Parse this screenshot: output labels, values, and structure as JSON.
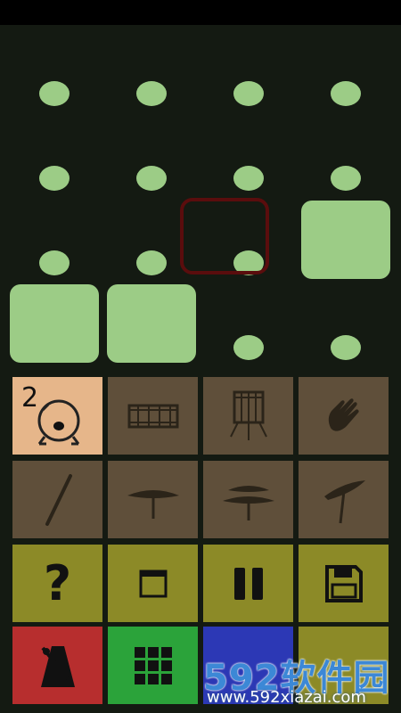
{
  "grid": {
    "dots": [
      {
        "row": 0,
        "col": 0
      },
      {
        "row": 0,
        "col": 1
      },
      {
        "row": 0,
        "col": 2
      },
      {
        "row": 0,
        "col": 3
      },
      {
        "row": 1,
        "col": 0
      },
      {
        "row": 1,
        "col": 1
      },
      {
        "row": 1,
        "col": 2
      },
      {
        "row": 1,
        "col": 3
      },
      {
        "row": 2,
        "col": 0
      },
      {
        "row": 2,
        "col": 1
      },
      {
        "row": 2,
        "col": 2
      },
      {
        "row": 3,
        "col": 2
      },
      {
        "row": 3,
        "col": 3
      }
    ],
    "pads": [
      {
        "row": 2,
        "col": 3
      },
      {
        "row": 3,
        "col": 0
      },
      {
        "row": 3,
        "col": 1
      }
    ],
    "cursor": {
      "row": 2,
      "col": 2
    }
  },
  "instruments": {
    "kick_label": "2",
    "row1": [
      "bass-drum-icon",
      "snare-drum-icon",
      "floor-tom-icon",
      "hand-clap-icon"
    ],
    "row2": [
      "drumstick-icon",
      "hihat-closed-icon",
      "hihat-open-icon",
      "crash-cymbal-icon"
    ]
  },
  "controls": {
    "help_label": "?"
  },
  "watermark": {
    "title": "592软件园",
    "url": "www.592xiazai.com"
  },
  "colors": {
    "dot": "#9ccc86",
    "instrument_bg": "#5f4f3a",
    "instrument_active": "#e6b68a",
    "control_bg": "#8c8a27",
    "metronome_bg": "#b72e2e",
    "grid_bg": "#2ba33a",
    "blue_bg": "#2c38b5"
  }
}
